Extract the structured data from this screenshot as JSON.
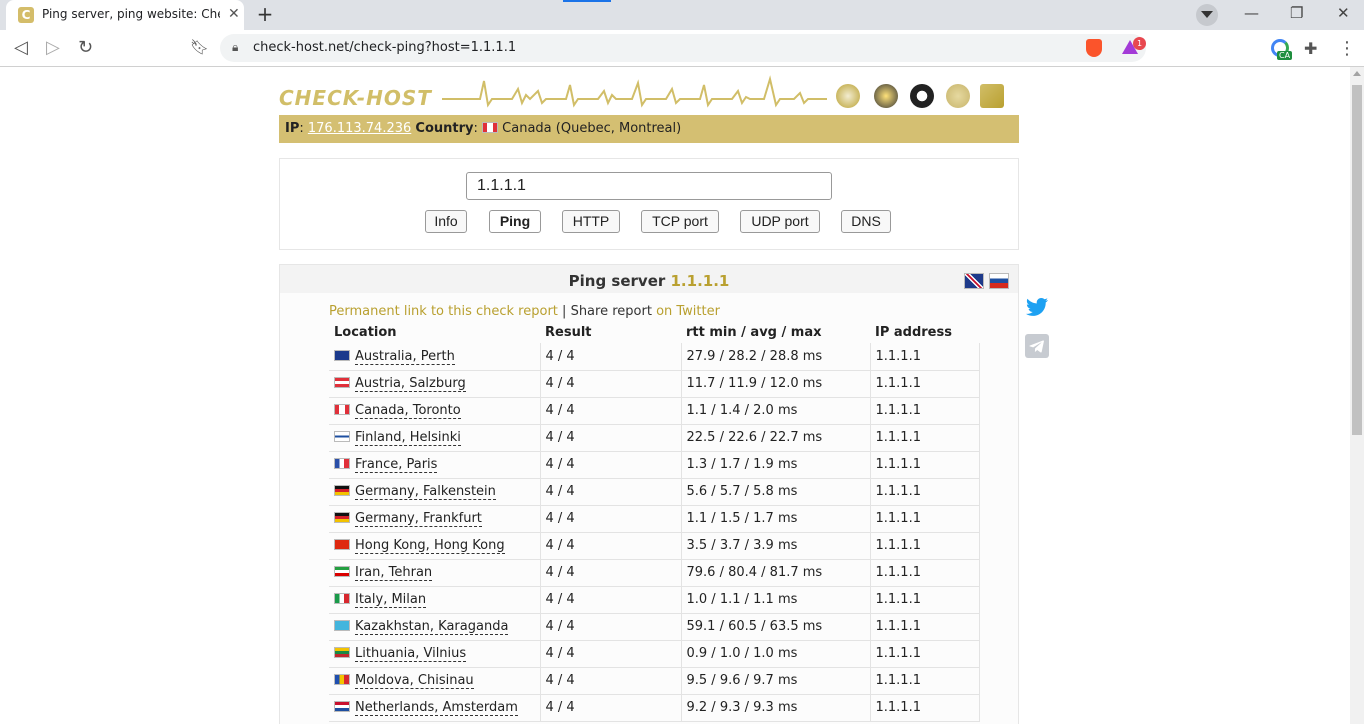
{
  "browser": {
    "tab_title": "Ping server, ping website: Check h",
    "url": "check-host.net/check-ping?host=1.1.1.1",
    "rewards_badge": "1",
    "ext_badge": "CA"
  },
  "header": {
    "logo_text": "CHECK-HOST"
  },
  "ipbar": {
    "ip_label": "IP",
    "ip_value": "176.113.74.236",
    "country_label": "Country",
    "country_value": "Canada (Quebec, Montreal)"
  },
  "form": {
    "host_value": "1.1.1.1",
    "buttons": [
      "Info",
      "Ping",
      "HTTP",
      "TCP port",
      "UDP port",
      "DNS"
    ],
    "active_button": "Ping"
  },
  "result": {
    "title_prefix": "Ping server",
    "title_host": "1.1.1.1",
    "permalink_text": "Permanent link to this check report",
    "separator": "|",
    "share_text": "Share report",
    "twitter_text": "on Twitter",
    "columns": [
      "Location",
      "Result",
      "rtt min / avg / max",
      "IP address"
    ],
    "rows": [
      {
        "flag": "au",
        "location": "Australia, Perth",
        "result": "4 / 4",
        "rtt": "27.9 / 28.2 / 28.8 ms",
        "ip": "1.1.1.1"
      },
      {
        "flag": "at",
        "location": "Austria, Salzburg",
        "result": "4 / 4",
        "rtt": "11.7 / 11.9 / 12.0 ms",
        "ip": "1.1.1.1"
      },
      {
        "flag": "ca",
        "location": "Canada, Toronto",
        "result": "4 / 4",
        "rtt": "1.1 / 1.4 / 2.0 ms",
        "ip": "1.1.1.1"
      },
      {
        "flag": "fi",
        "location": "Finland, Helsinki",
        "result": "4 / 4",
        "rtt": "22.5 / 22.6 / 22.7 ms",
        "ip": "1.1.1.1"
      },
      {
        "flag": "fr",
        "location": "France, Paris",
        "result": "4 / 4",
        "rtt": "1.3 / 1.7 / 1.9 ms",
        "ip": "1.1.1.1"
      },
      {
        "flag": "de",
        "location": "Germany, Falkenstein",
        "result": "4 / 4",
        "rtt": "5.6 / 5.7 / 5.8 ms",
        "ip": "1.1.1.1"
      },
      {
        "flag": "de",
        "location": "Germany, Frankfurt",
        "result": "4 / 4",
        "rtt": "1.1 / 1.5 / 1.7 ms",
        "ip": "1.1.1.1"
      },
      {
        "flag": "hk",
        "location": "Hong Kong, Hong Kong",
        "result": "4 / 4",
        "rtt": "3.5 / 3.7 / 3.9 ms",
        "ip": "1.1.1.1"
      },
      {
        "flag": "ir",
        "location": "Iran, Tehran",
        "result": "4 / 4",
        "rtt": "79.6 / 80.4 / 81.7 ms",
        "ip": "1.1.1.1"
      },
      {
        "flag": "it",
        "location": "Italy, Milan",
        "result": "4 / 4",
        "rtt": "1.0 / 1.1 / 1.1 ms",
        "ip": "1.1.1.1"
      },
      {
        "flag": "kz",
        "location": "Kazakhstan, Karaganda",
        "result": "4 / 4",
        "rtt": "59.1 / 60.5 / 63.5 ms",
        "ip": "1.1.1.1"
      },
      {
        "flag": "lt",
        "location": "Lithuania, Vilnius",
        "result": "4 / 4",
        "rtt": "0.9 / 1.0 / 1.0 ms",
        "ip": "1.1.1.1"
      },
      {
        "flag": "md",
        "location": "Moldova, Chisinau",
        "result": "4 / 4",
        "rtt": "9.5 / 9.6 / 9.7 ms",
        "ip": "1.1.1.1"
      },
      {
        "flag": "nl",
        "location": "Netherlands, Amsterdam",
        "result": "4 / 4",
        "rtt": "9.2 / 9.3 / 9.3 ms",
        "ip": "1.1.1.1"
      }
    ]
  },
  "flag_colors": {
    "au": "linear-gradient(#1b3a8c,#1b3a8c)",
    "at": "linear-gradient(#e0303a 33%,#fff 33%,#fff 66%,#e0303a 66%)",
    "ca": "linear-gradient(90deg,#e0303a 28%,#fff 28%,#fff 72%,#e0303a 72%)",
    "fi": "linear-gradient(#fff 38%,#1e4fa0 38%,#1e4fa0 62%,#fff 62%)",
    "fr": "linear-gradient(90deg,#2a4fa8 33%,#fff 33%,#fff 66%,#e0303a 66%)",
    "de": "linear-gradient(#111 33%,#d5202a 33%,#d5202a 66%,#f2c200 66%)",
    "hk": "linear-gradient(#de2910,#de2910)",
    "ir": "linear-gradient(#239f40 33%,#fff 33%,#fff 66%,#da0000 66%)",
    "it": "linear-gradient(90deg,#1a9a4a 33%,#fff 33%,#fff 66%,#d7282f 66%)",
    "kz": "linear-gradient(#43b5dd,#43b5dd)",
    "lt": "linear-gradient(#f3c300 33%,#1a8a44 33%,#1a8a44 66%,#c1272d 66%)",
    "md": "linear-gradient(90deg,#1f4fb0 33%,#f3c300 33%,#f3c300 66%,#d7282f 66%)",
    "nl": "linear-gradient(#c8102e 33%,#fff 33%,#fff 66%,#1e4fa0 66%)"
  },
  "colors": {
    "brand_gold": "#d4bf72",
    "link_gold": "#b9a030"
  }
}
